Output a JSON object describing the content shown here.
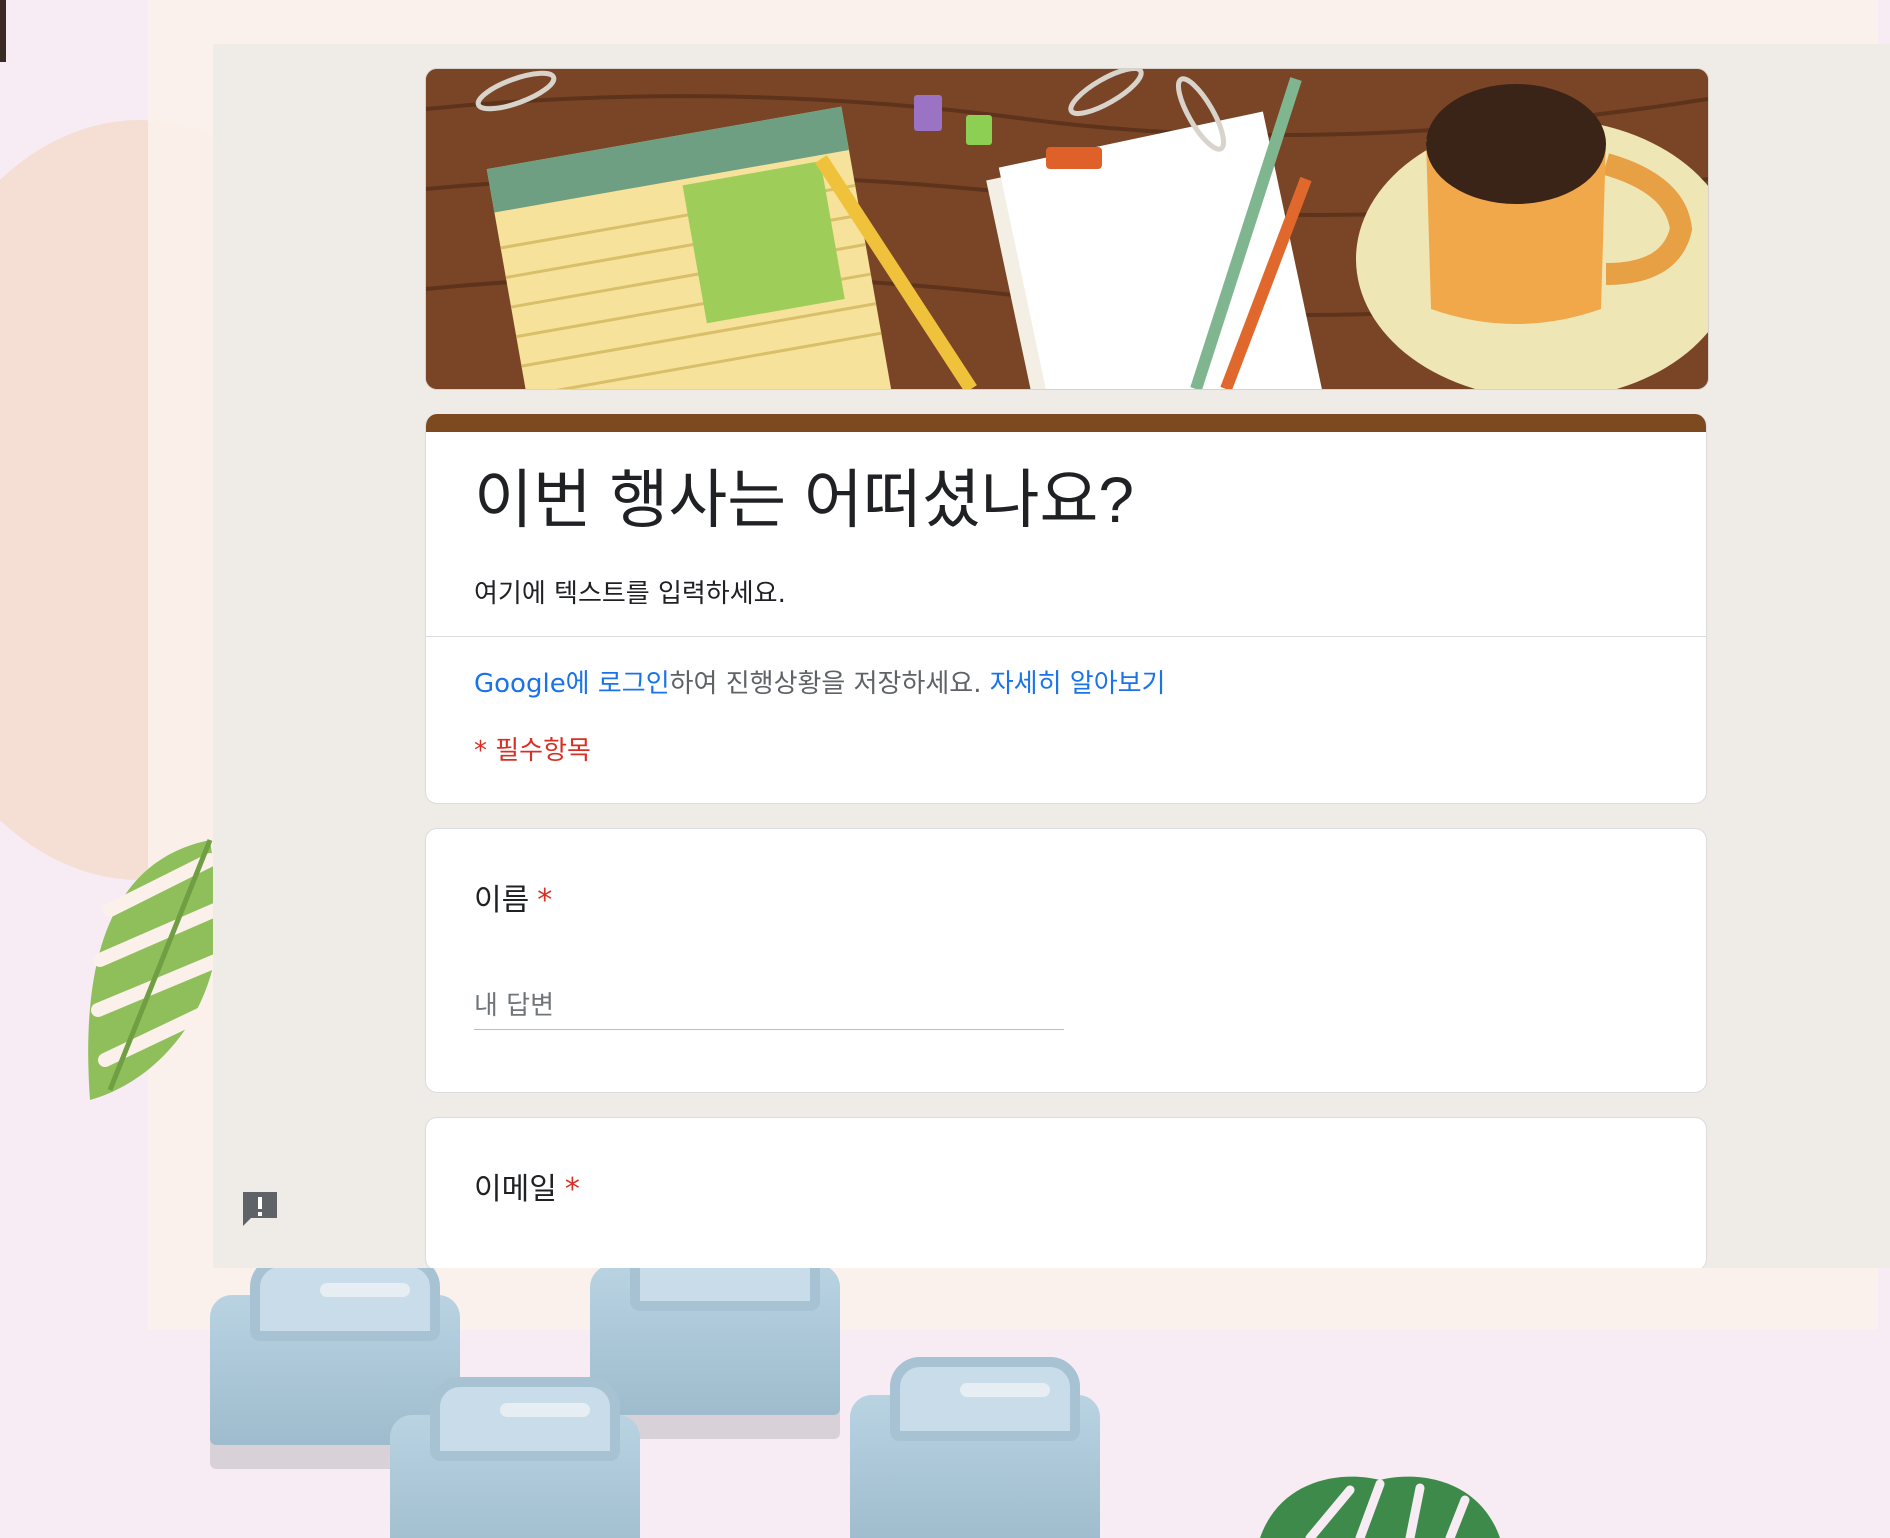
{
  "form": {
    "title": "이번 행사는 어떠셨나요?",
    "description": "여기에 텍스트를 입력하세요.",
    "signin": {
      "link_google": "Google에 로그인",
      "middle_text": "하여 진행상황을 저장하세요.",
      "learn_more": "자세히 알아보기"
    },
    "required_note": "* 필수항목",
    "questions": [
      {
        "label": "이름",
        "required_mark": "*",
        "placeholder": "내 답변"
      },
      {
        "label": "이메일",
        "required_mark": "*"
      }
    ]
  },
  "feedback": {
    "icon": "feedback-icon"
  },
  "colors": {
    "theme_accent": "#7c4a1e",
    "link": "#1a73e8",
    "required": "#d93025",
    "form_background": "#efebe6"
  }
}
